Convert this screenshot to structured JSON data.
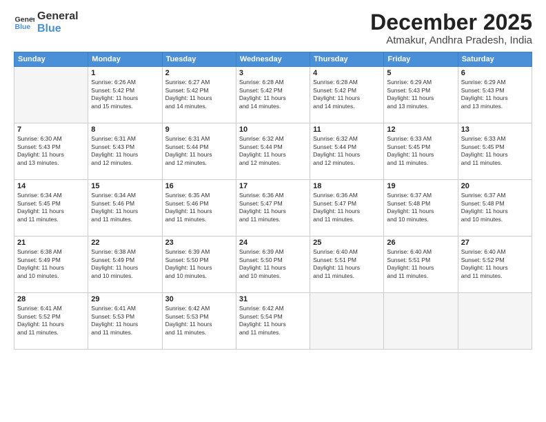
{
  "header": {
    "logo_line1": "General",
    "logo_line2": "Blue",
    "month": "December 2025",
    "location": "Atmakur, Andhra Pradesh, India"
  },
  "weekdays": [
    "Sunday",
    "Monday",
    "Tuesday",
    "Wednesday",
    "Thursday",
    "Friday",
    "Saturday"
  ],
  "weeks": [
    [
      {
        "day": "",
        "info": ""
      },
      {
        "day": "1",
        "info": "Sunrise: 6:26 AM\nSunset: 5:42 PM\nDaylight: 11 hours\nand 15 minutes."
      },
      {
        "day": "2",
        "info": "Sunrise: 6:27 AM\nSunset: 5:42 PM\nDaylight: 11 hours\nand 14 minutes."
      },
      {
        "day": "3",
        "info": "Sunrise: 6:28 AM\nSunset: 5:42 PM\nDaylight: 11 hours\nand 14 minutes."
      },
      {
        "day": "4",
        "info": "Sunrise: 6:28 AM\nSunset: 5:42 PM\nDaylight: 11 hours\nand 14 minutes."
      },
      {
        "day": "5",
        "info": "Sunrise: 6:29 AM\nSunset: 5:43 PM\nDaylight: 11 hours\nand 13 minutes."
      },
      {
        "day": "6",
        "info": "Sunrise: 6:29 AM\nSunset: 5:43 PM\nDaylight: 11 hours\nand 13 minutes."
      }
    ],
    [
      {
        "day": "7",
        "info": "Sunrise: 6:30 AM\nSunset: 5:43 PM\nDaylight: 11 hours\nand 13 minutes."
      },
      {
        "day": "8",
        "info": "Sunrise: 6:31 AM\nSunset: 5:43 PM\nDaylight: 11 hours\nand 12 minutes."
      },
      {
        "day": "9",
        "info": "Sunrise: 6:31 AM\nSunset: 5:44 PM\nDaylight: 11 hours\nand 12 minutes."
      },
      {
        "day": "10",
        "info": "Sunrise: 6:32 AM\nSunset: 5:44 PM\nDaylight: 11 hours\nand 12 minutes."
      },
      {
        "day": "11",
        "info": "Sunrise: 6:32 AM\nSunset: 5:44 PM\nDaylight: 11 hours\nand 12 minutes."
      },
      {
        "day": "12",
        "info": "Sunrise: 6:33 AM\nSunset: 5:45 PM\nDaylight: 11 hours\nand 11 minutes."
      },
      {
        "day": "13",
        "info": "Sunrise: 6:33 AM\nSunset: 5:45 PM\nDaylight: 11 hours\nand 11 minutes."
      }
    ],
    [
      {
        "day": "14",
        "info": "Sunrise: 6:34 AM\nSunset: 5:45 PM\nDaylight: 11 hours\nand 11 minutes."
      },
      {
        "day": "15",
        "info": "Sunrise: 6:34 AM\nSunset: 5:46 PM\nDaylight: 11 hours\nand 11 minutes."
      },
      {
        "day": "16",
        "info": "Sunrise: 6:35 AM\nSunset: 5:46 PM\nDaylight: 11 hours\nand 11 minutes."
      },
      {
        "day": "17",
        "info": "Sunrise: 6:36 AM\nSunset: 5:47 PM\nDaylight: 11 hours\nand 11 minutes."
      },
      {
        "day": "18",
        "info": "Sunrise: 6:36 AM\nSunset: 5:47 PM\nDaylight: 11 hours\nand 11 minutes."
      },
      {
        "day": "19",
        "info": "Sunrise: 6:37 AM\nSunset: 5:48 PM\nDaylight: 11 hours\nand 10 minutes."
      },
      {
        "day": "20",
        "info": "Sunrise: 6:37 AM\nSunset: 5:48 PM\nDaylight: 11 hours\nand 10 minutes."
      }
    ],
    [
      {
        "day": "21",
        "info": "Sunrise: 6:38 AM\nSunset: 5:49 PM\nDaylight: 11 hours\nand 10 minutes."
      },
      {
        "day": "22",
        "info": "Sunrise: 6:38 AM\nSunset: 5:49 PM\nDaylight: 11 hours\nand 10 minutes."
      },
      {
        "day": "23",
        "info": "Sunrise: 6:39 AM\nSunset: 5:50 PM\nDaylight: 11 hours\nand 10 minutes."
      },
      {
        "day": "24",
        "info": "Sunrise: 6:39 AM\nSunset: 5:50 PM\nDaylight: 11 hours\nand 10 minutes."
      },
      {
        "day": "25",
        "info": "Sunrise: 6:40 AM\nSunset: 5:51 PM\nDaylight: 11 hours\nand 11 minutes."
      },
      {
        "day": "26",
        "info": "Sunrise: 6:40 AM\nSunset: 5:51 PM\nDaylight: 11 hours\nand 11 minutes."
      },
      {
        "day": "27",
        "info": "Sunrise: 6:40 AM\nSunset: 5:52 PM\nDaylight: 11 hours\nand 11 minutes."
      }
    ],
    [
      {
        "day": "28",
        "info": "Sunrise: 6:41 AM\nSunset: 5:52 PM\nDaylight: 11 hours\nand 11 minutes."
      },
      {
        "day": "29",
        "info": "Sunrise: 6:41 AM\nSunset: 5:53 PM\nDaylight: 11 hours\nand 11 minutes."
      },
      {
        "day": "30",
        "info": "Sunrise: 6:42 AM\nSunset: 5:53 PM\nDaylight: 11 hours\nand 11 minutes."
      },
      {
        "day": "31",
        "info": "Sunrise: 6:42 AM\nSunset: 5:54 PM\nDaylight: 11 hours\nand 11 minutes."
      },
      {
        "day": "",
        "info": ""
      },
      {
        "day": "",
        "info": ""
      },
      {
        "day": "",
        "info": ""
      }
    ]
  ]
}
